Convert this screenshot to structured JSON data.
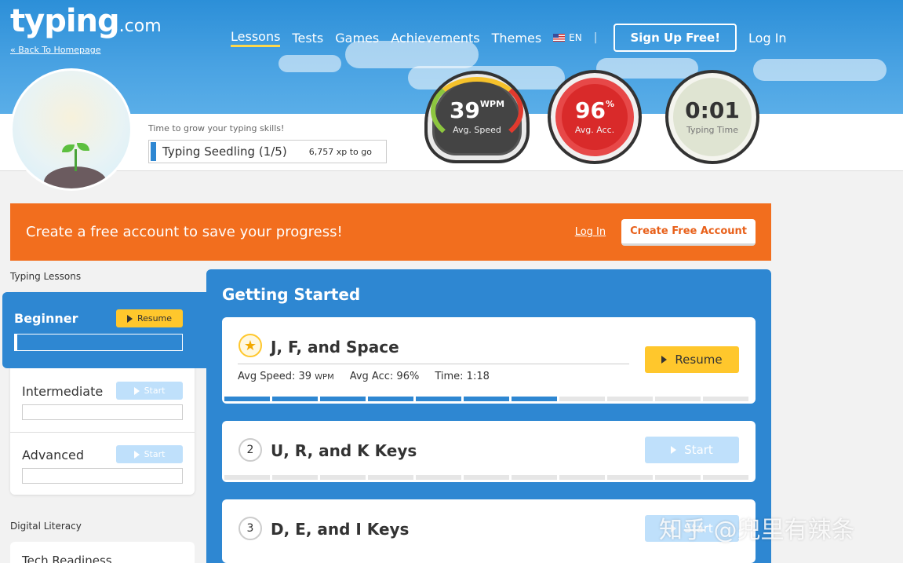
{
  "header": {
    "logo_main": "typing",
    "logo_suffix": ".com",
    "back_link": "« Back To Homepage",
    "nav": [
      {
        "label": "Lessons",
        "active": true
      },
      {
        "label": "Tests",
        "active": false
      },
      {
        "label": "Games",
        "active": false
      },
      {
        "label": "Achievements",
        "active": false
      },
      {
        "label": "Themes",
        "active": false
      }
    ],
    "language": "EN",
    "signup": "Sign Up Free!",
    "login": "Log In"
  },
  "profile": {
    "grow_text": "Time to grow your typing skills!",
    "rank": "Typing Seedling (1/5)",
    "xp": "6,757 xp to go"
  },
  "gauges": {
    "speed_value": "39",
    "speed_unit": "WPM",
    "speed_label": "Avg. Speed",
    "acc_value": "96",
    "acc_unit": "%",
    "acc_label": "Avg. Acc.",
    "time_value": "0:01",
    "time_label": "Typing Time"
  },
  "banner": {
    "text": "Create a free account to save your progress!",
    "login": "Log In",
    "create": "Create Free Account"
  },
  "sidebar": {
    "heading": "Typing Lessons",
    "levels": [
      {
        "title": "Beginner",
        "button": "Resume"
      },
      {
        "title": "Intermediate",
        "button": "Start"
      },
      {
        "title": "Advanced",
        "button": "Start"
      }
    ],
    "digital_heading": "Digital Literacy",
    "digital_item": "Tech Readiness"
  },
  "main": {
    "title": "Getting Started",
    "lessons": [
      {
        "number": "",
        "title": "J, F, and Space",
        "button": "Resume",
        "stats": {
          "speed_label": "Avg Speed:",
          "speed": "39",
          "speed_unit": "WPM",
          "acc_label": "Avg Acc:",
          "acc": "96%",
          "time_label": "Time:",
          "time": "1:18"
        },
        "progress_segments": 7,
        "total_segments": 11
      },
      {
        "number": "2",
        "title": "U, R, and K Keys",
        "button": "Start",
        "progress_segments": 0,
        "total_segments": 11
      },
      {
        "number": "3",
        "title": "D, E, and I Keys",
        "button": "Start",
        "progress_segments": 0,
        "total_segments": 11
      }
    ]
  },
  "watermark": "知乎 @兜里有辣条",
  "colors": {
    "sky": "#2c8fd8",
    "orange": "#f26e1e",
    "yellow": "#ffc72c",
    "blue": "#2e87d2"
  }
}
